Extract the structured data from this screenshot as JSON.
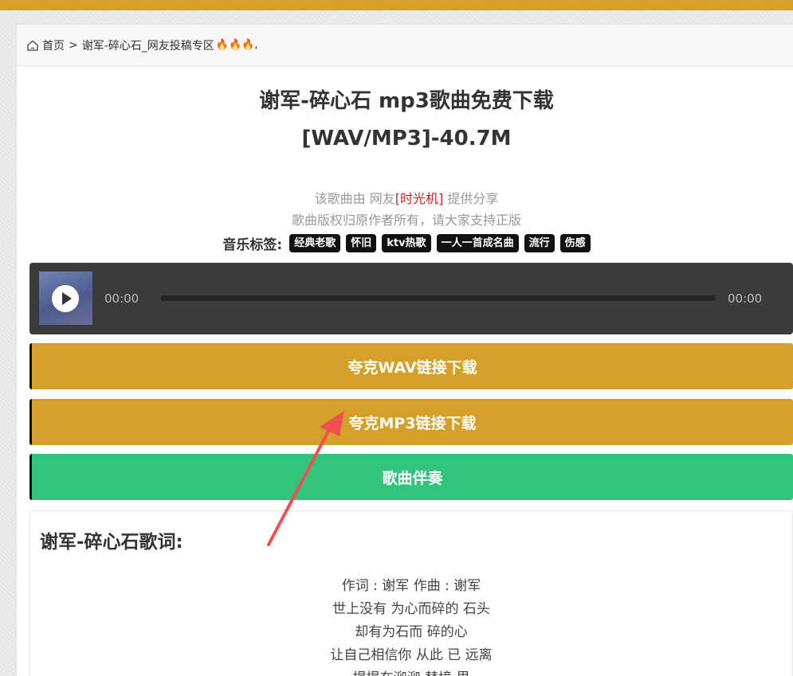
{
  "breadcrumb": {
    "home": "首页",
    "separator": ">",
    "current": "谢军-碎心石_网友投稿专区",
    "suffix": "🔥🔥🔥,"
  },
  "song": {
    "title": "谢军-碎心石 mp3歌曲免费下载",
    "format_size": "[WAV/MP3]-40.7M"
  },
  "share": {
    "prefix": "该歌曲由 网友",
    "uploader": "[时光机]",
    "suffix": " 提供分享",
    "copyright": "歌曲版权归原作者所有，请大家支持正版"
  },
  "tags": {
    "label": "音乐标签:",
    "items": [
      "经典老歌",
      "怀旧",
      "ktv热歌",
      "一人一首成名曲",
      "流行",
      "伤感"
    ]
  },
  "player": {
    "current_time": "00:00",
    "duration": "00:00",
    "progress": 0
  },
  "buttons": {
    "wav": "夸克WAV链接下载",
    "mp3": "夸克MP3链接下载",
    "accompaniment": "歌曲伴奏"
  },
  "lyrics": {
    "heading": "谢军-碎心石歌词:",
    "lines": [
      "作词 : 谢军 作曲 : 谢军",
      "世上没有 为心而碎的 石头",
      "却有为石而 碎的心",
      "让自己相信你 从此 已 远离",
      "提提在泖泖 替境 里"
    ]
  },
  "colors": {
    "accent_gold": "#d4a028",
    "accent_green": "#31c47c",
    "uploader_red": "#e02020",
    "player_bg": "#3b3b3b",
    "annotation_arrow": "#f05050"
  },
  "icons": [
    "home-icon",
    "fire-icon",
    "play-icon",
    "arrow-annotation"
  ]
}
